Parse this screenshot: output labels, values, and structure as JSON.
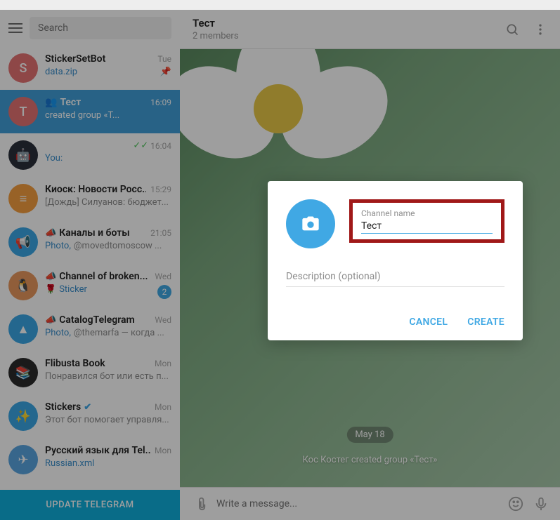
{
  "search": {
    "placeholder": "Search"
  },
  "chats": [
    {
      "name": "StickerSetBot",
      "time": "Tue",
      "preview": "data.zip",
      "pinned": true
    },
    {
      "name": "Тест",
      "time": "16:09",
      "preview": "created group «Т...",
      "selected": true,
      "group": true
    },
    {
      "name": "",
      "time": "16:04",
      "preview": "You:",
      "checks": true
    },
    {
      "name": "Киоск: Новости Росс...",
      "time": "15:29",
      "preview": "[Дождь]  Силуанов: бюджет..."
    },
    {
      "name": "Каналы и боты",
      "time": "21:05",
      "prefix": "Photo, ",
      "preview": "@movedtomoscow ..."
    },
    {
      "name": "Channel of broken...",
      "time": "Wed",
      "preview": "Sticker",
      "badge": "2",
      "rose": true
    },
    {
      "name": "CatalogTelegram",
      "time": "Wed",
      "prefix": "Photo, ",
      "preview": "@themarfa — когда ..."
    },
    {
      "name": "Flibusta Book",
      "time": "Mon",
      "preview": "Понравился бот или есть п..."
    },
    {
      "name": "Stickers",
      "time": "Mon",
      "preview": "Этот бот помогает управля...",
      "verified": true
    },
    {
      "name": "Русский язык для Tel...",
      "time": "Mon",
      "preview": "Russian.xml"
    }
  ],
  "update": "UPDATE TELEGRAM",
  "header": {
    "title": "Тест",
    "subtitle": "2 members"
  },
  "date_chip": "May 18",
  "sys_msg": "Кос Костег created group «Тест»",
  "composer": {
    "placeholder": "Write a message..."
  },
  "modal": {
    "name_label": "Channel name",
    "name_value": "Тест",
    "desc_placeholder": "Description (optional)",
    "cancel": "CANCEL",
    "create": "CREATE"
  }
}
